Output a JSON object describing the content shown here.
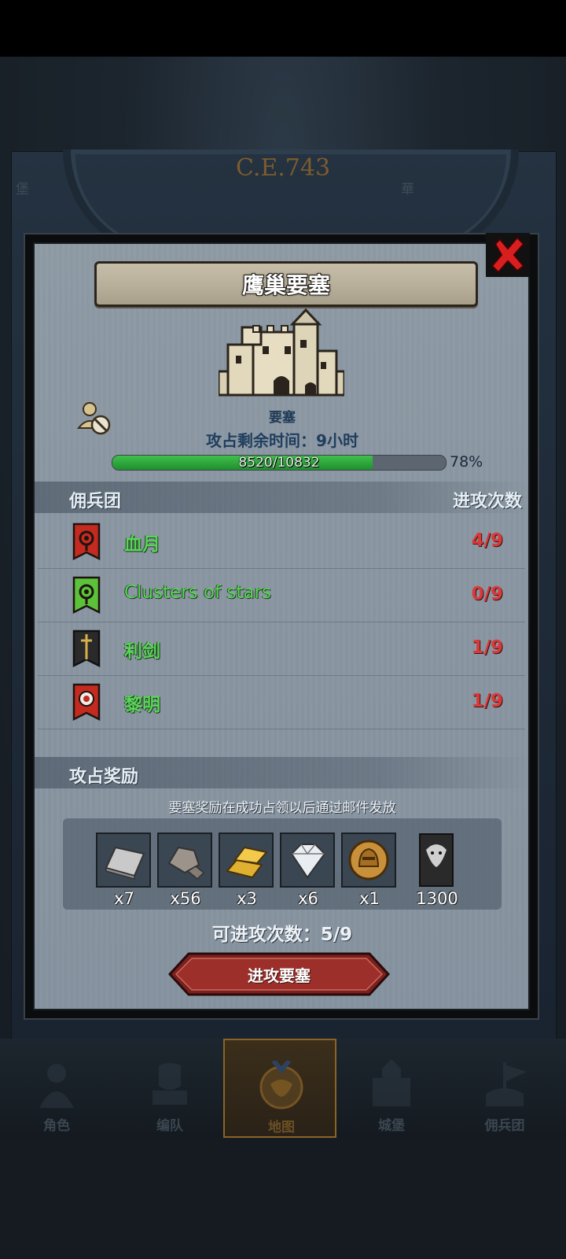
{
  "header": {
    "era": "C.E.743",
    "left_label": "堡",
    "right_label": "華"
  },
  "dialog": {
    "title": "鹰巢要塞",
    "fortress_type": "要塞",
    "time_label": "攻占剩余时间：9小时",
    "hp": {
      "current": 8520,
      "max": 10832,
      "text": "8520/10832",
      "percent_text": "78%",
      "fraction": 0.78
    },
    "mercenary_header": {
      "left": "佣兵团",
      "right": "进攻次数"
    },
    "mercenaries": [
      {
        "name": "血月",
        "count": "4/9",
        "emblem": "red-eye-banner"
      },
      {
        "name": "Clusters of stars",
        "count": "0/9",
        "emblem": "green-eye-banner"
      },
      {
        "name": "利剑",
        "count": "1/9",
        "emblem": "sword-banner"
      },
      {
        "name": "黎明",
        "count": "1/9",
        "emblem": "red-dawn-banner"
      }
    ],
    "reward_header": "攻占奖励",
    "reward_note": "要塞奖励在成功占领以后通过邮件发放",
    "rewards": [
      {
        "icon": "silver-ingot-icon",
        "qty": "x7"
      },
      {
        "icon": "stone-ore-icon",
        "qty": "x56"
      },
      {
        "icon": "gold-bars-icon",
        "qty": "x3"
      },
      {
        "icon": "diamond-icon",
        "qty": "x6"
      },
      {
        "icon": "knight-coin-icon",
        "qty": "x1"
      },
      {
        "icon": "beast-banner-icon",
        "qty": "1300"
      }
    ],
    "attack_count": "可进攻次数：5/9",
    "attack_button": "进攻要塞"
  },
  "nav": [
    {
      "label": "角色",
      "icon": "character-icon"
    },
    {
      "label": "编队",
      "icon": "formation-icon"
    },
    {
      "label": "地图",
      "icon": "map-icon",
      "active": true
    },
    {
      "label": "城堡",
      "icon": "castle-icon"
    },
    {
      "label": "佣兵团",
      "icon": "mercenary-icon"
    }
  ]
}
